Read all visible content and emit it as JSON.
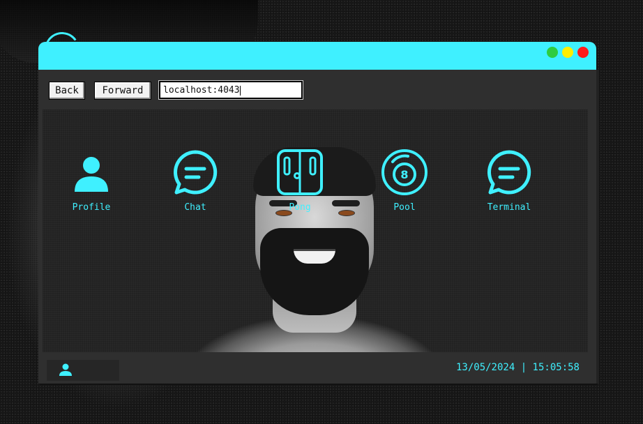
{
  "browser": {
    "back_label": "Back",
    "forward_label": "Forward",
    "url": "localhost:4043",
    "window_controls": [
      "minimize",
      "maximize",
      "close"
    ]
  },
  "desktop": {
    "icons": [
      {
        "label": "Profile",
        "icon": "user-icon"
      },
      {
        "label": "Chat",
        "icon": "chat-bubble-icon"
      },
      {
        "label": "Pong",
        "icon": "pong-icon"
      },
      {
        "label": "Pool",
        "icon": "eight-ball-icon"
      },
      {
        "label": "Terminal",
        "icon": "chat-bubble-icon"
      }
    ]
  },
  "taskbar": {
    "user_icon": "user-icon",
    "datetime": "13/05/2024 | 15:05:58"
  },
  "colors": {
    "accent": "#3ff0ff",
    "window": "#2f2f2f",
    "desktop": "#202020",
    "minimize": "#2ecc40",
    "maximize": "#ffee00",
    "close": "#ff1a1a"
  }
}
